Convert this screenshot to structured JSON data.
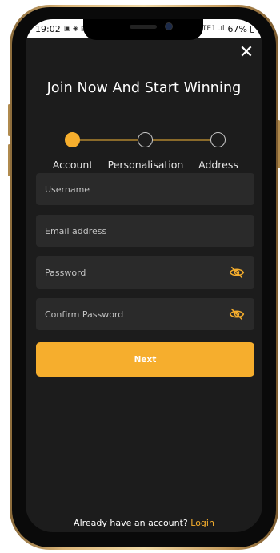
{
  "status_bar": {
    "time": "19:02",
    "left_icons": "▣ ◈ ▤",
    "signal_text": "⚙ Vo) LTE1 .ıl",
    "battery": "67%"
  },
  "modal": {
    "close_icon": "✕",
    "title": "Join Now And Start Winning"
  },
  "stepper": {
    "steps": [
      {
        "label": "Account",
        "active": true
      },
      {
        "label": "Personalisation",
        "active": false
      },
      {
        "label": "Address",
        "active": false
      }
    ]
  },
  "form": {
    "username_placeholder": "Username",
    "email_placeholder": "Email address",
    "password_placeholder": "Password",
    "confirm_password_placeholder": "Confirm Password",
    "next_label": "Next"
  },
  "footer": {
    "prompt": "Already have an account?",
    "login_label": "Login"
  },
  "colors": {
    "accent": "#f6ae2d",
    "background": "#1c1c1c",
    "field": "#2a2a2a"
  },
  "icons": {
    "close": "close-icon",
    "password_visibility": "eye-slash-icon"
  }
}
